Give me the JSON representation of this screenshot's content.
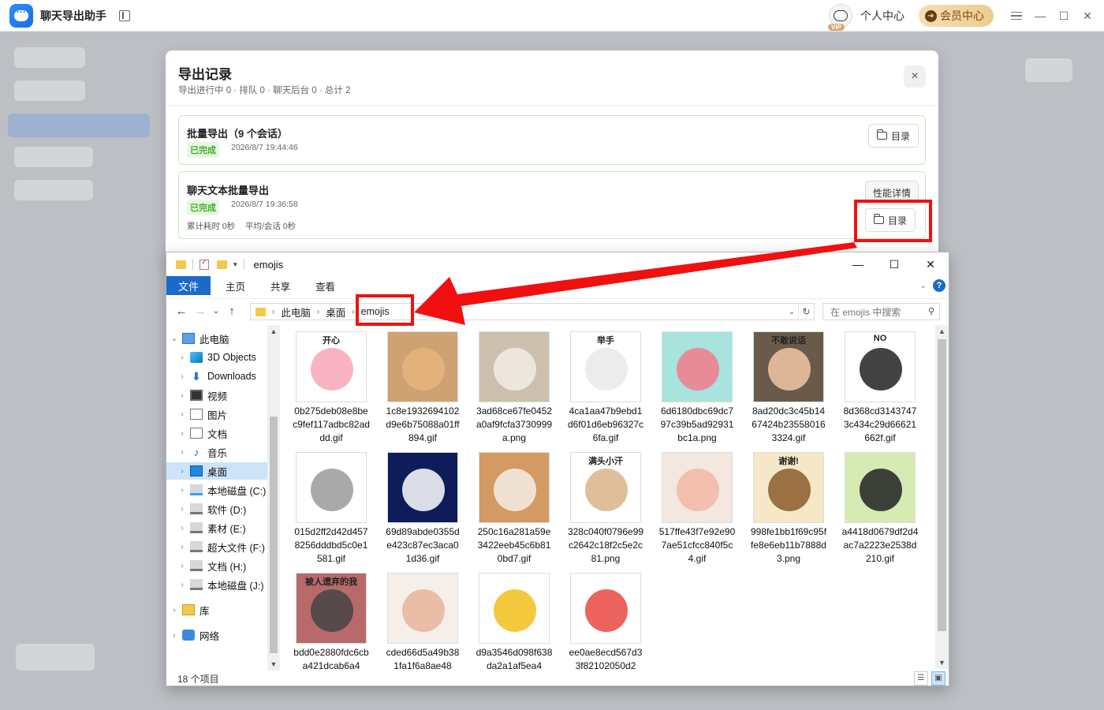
{
  "app": {
    "title": "聊天导出助手",
    "personal_center": "个人中心",
    "vip_tag": "VIP",
    "member_center": "会员中心"
  },
  "modal": {
    "title": "导出记录",
    "subtitle": "导出进行中 0 · 排队 0 · 聊天后台 0 · 总计 2",
    "close": "×",
    "records": [
      {
        "title": "批量导出（9 个会话）",
        "status": "已完成",
        "time": "2026/8/7 19:44:46",
        "dir_label": "目录"
      },
      {
        "title": "聊天文本批量导出",
        "status": "已完成",
        "time": "2026/8/7 19:36:58",
        "total_time": "累计耗时 0秒",
        "avg_time": "平均/会话 0秒",
        "perf_label": "性能详情",
        "dir_label": "目录"
      }
    ]
  },
  "explorer": {
    "title": "emojis",
    "ribbon": {
      "file": "文件",
      "tabs": [
        "主页",
        "共享",
        "查看"
      ]
    },
    "breadcrumb": [
      "此电脑",
      "桌面",
      "emojis"
    ],
    "search_placeholder": "在 emojis 中搜索",
    "nav_items": [
      {
        "label": "此电脑",
        "icon": "pc-icon",
        "level": 0,
        "expanded": true
      },
      {
        "label": "3D Objects",
        "icon": "3d-objects-icon",
        "level": 1
      },
      {
        "label": "Downloads",
        "icon": "downloads-icon",
        "level": 1
      },
      {
        "label": "视频",
        "icon": "video-icon",
        "level": 1
      },
      {
        "label": "图片",
        "icon": "pictures-icon",
        "level": 1
      },
      {
        "label": "文档",
        "icon": "documents-icon",
        "level": 1
      },
      {
        "label": "音乐",
        "icon": "music-icon",
        "level": 1
      },
      {
        "label": "桌面",
        "icon": "desktop-icon",
        "level": 1,
        "selected": true
      },
      {
        "label": "本地磁盘 (C:)",
        "icon": "drive-c-icon",
        "level": 1
      },
      {
        "label": "软件 (D:)",
        "icon": "drive-icon",
        "level": 1
      },
      {
        "label": "素材 (E:)",
        "icon": "drive-icon",
        "level": 1
      },
      {
        "label": "超大文件 (F:)",
        "icon": "drive-icon",
        "level": 1
      },
      {
        "label": "文档 (H:)",
        "icon": "drive-icon",
        "level": 1
      },
      {
        "label": "本地磁盘 (J:)",
        "icon": "drive-icon",
        "level": 1
      },
      {
        "label": "库",
        "icon": "library-icon",
        "level": 0
      },
      {
        "label": "网络",
        "icon": "network-icon",
        "level": 0
      }
    ],
    "files": [
      {
        "name": "0b275deb08e8bec9fef117adbc82addd.gif",
        "thumb": "pig-sticker",
        "caption": "开心"
      },
      {
        "name": "1c8e1932694102d9e6b75088a01ff894.gif",
        "thumb": "orange-cat"
      },
      {
        "name": "3ad68ce67fe0452a0af9fcfa3730999a.png",
        "thumb": "white-cat-up"
      },
      {
        "name": "4ca1aa47b9ebd1d6f01d6eb96327c6fa.gif",
        "thumb": "mushroom-sticker",
        "caption": "举手"
      },
      {
        "name": "6d6180dbc69dc797c39b5ad92931bc1a.png",
        "thumb": "heart-cat"
      },
      {
        "name": "8ad20dc3c45b1467424b235580163324.gif",
        "thumb": "baby-girl",
        "caption": "不敢说话"
      },
      {
        "name": "8d368cd31437473c434c29d66621662f.gif",
        "thumb": "penguin-no",
        "caption": "NO"
      },
      {
        "name": "015d2ff2d42d4578256dddbd5c0e1581.gif",
        "thumb": "grey-cat"
      },
      {
        "name": "69d89abde0355de423c87ec3aca01d36.gif",
        "thumb": "ghost-navy"
      },
      {
        "name": "250c16a281a59e3422eeb45c6b810bd7.gif",
        "thumb": "cat-closeup"
      },
      {
        "name": "328c040f0796e99c2642c18f2c5e2c81.png",
        "thumb": "sweaty-cat",
        "caption": "满头小汗"
      },
      {
        "name": "517ffe43f7e92e907ae51cfcc840f5c4.gif",
        "thumb": "baby-drink"
      },
      {
        "name": "998fe1bb1f69c95ffe8e6eb11b7888d3.png",
        "thumb": "paw-thanks",
        "caption": "谢谢!"
      },
      {
        "name": "a4418d0679df2d4ac7a2223e2538d210.gif",
        "thumb": "cow-sticker"
      },
      {
        "name": "bdd0e2880fdc6cba421dcab6a4",
        "thumb": "abandoned",
        "caption": "被人遗弃的我"
      },
      {
        "name": "cded66d5a49b381fa1f6a8ae48",
        "thumb": "baby-straw"
      },
      {
        "name": "d9a3546d098f638da2a1af5ea4",
        "thumb": "yellow-duck"
      },
      {
        "name": "ee0ae8ecd567d33f82102050d2",
        "thumb": "glasses-duck"
      }
    ],
    "status": "18 个项目"
  },
  "colors": {
    "accent_blue": "#1b6ac9",
    "success_green": "#3fae2a",
    "highlight_red": "#f01010"
  }
}
